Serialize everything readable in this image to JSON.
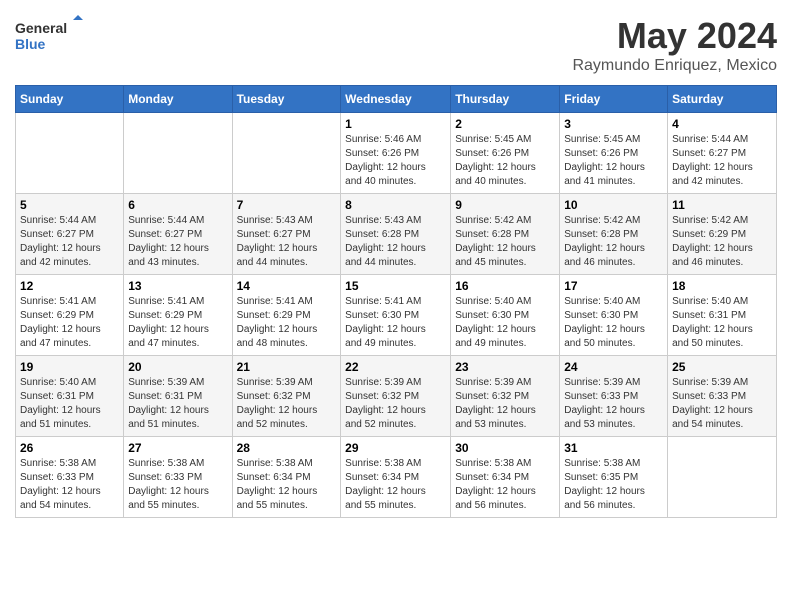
{
  "header": {
    "logo_line1": "General",
    "logo_line2": "Blue",
    "main_title": "May 2024",
    "subtitle": "Raymundo Enriquez, Mexico"
  },
  "days_of_week": [
    "Sunday",
    "Monday",
    "Tuesday",
    "Wednesday",
    "Thursday",
    "Friday",
    "Saturday"
  ],
  "weeks": [
    [
      {
        "day": "",
        "info": ""
      },
      {
        "day": "",
        "info": ""
      },
      {
        "day": "",
        "info": ""
      },
      {
        "day": "1",
        "info": "Sunrise: 5:46 AM\nSunset: 6:26 PM\nDaylight: 12 hours\nand 40 minutes."
      },
      {
        "day": "2",
        "info": "Sunrise: 5:45 AM\nSunset: 6:26 PM\nDaylight: 12 hours\nand 40 minutes."
      },
      {
        "day": "3",
        "info": "Sunrise: 5:45 AM\nSunset: 6:26 PM\nDaylight: 12 hours\nand 41 minutes."
      },
      {
        "day": "4",
        "info": "Sunrise: 5:44 AM\nSunset: 6:27 PM\nDaylight: 12 hours\nand 42 minutes."
      }
    ],
    [
      {
        "day": "5",
        "info": "Sunrise: 5:44 AM\nSunset: 6:27 PM\nDaylight: 12 hours\nand 42 minutes."
      },
      {
        "day": "6",
        "info": "Sunrise: 5:44 AM\nSunset: 6:27 PM\nDaylight: 12 hours\nand 43 minutes."
      },
      {
        "day": "7",
        "info": "Sunrise: 5:43 AM\nSunset: 6:27 PM\nDaylight: 12 hours\nand 44 minutes."
      },
      {
        "day": "8",
        "info": "Sunrise: 5:43 AM\nSunset: 6:28 PM\nDaylight: 12 hours\nand 44 minutes."
      },
      {
        "day": "9",
        "info": "Sunrise: 5:42 AM\nSunset: 6:28 PM\nDaylight: 12 hours\nand 45 minutes."
      },
      {
        "day": "10",
        "info": "Sunrise: 5:42 AM\nSunset: 6:28 PM\nDaylight: 12 hours\nand 46 minutes."
      },
      {
        "day": "11",
        "info": "Sunrise: 5:42 AM\nSunset: 6:29 PM\nDaylight: 12 hours\nand 46 minutes."
      }
    ],
    [
      {
        "day": "12",
        "info": "Sunrise: 5:41 AM\nSunset: 6:29 PM\nDaylight: 12 hours\nand 47 minutes."
      },
      {
        "day": "13",
        "info": "Sunrise: 5:41 AM\nSunset: 6:29 PM\nDaylight: 12 hours\nand 47 minutes."
      },
      {
        "day": "14",
        "info": "Sunrise: 5:41 AM\nSunset: 6:29 PM\nDaylight: 12 hours\nand 48 minutes."
      },
      {
        "day": "15",
        "info": "Sunrise: 5:41 AM\nSunset: 6:30 PM\nDaylight: 12 hours\nand 49 minutes."
      },
      {
        "day": "16",
        "info": "Sunrise: 5:40 AM\nSunset: 6:30 PM\nDaylight: 12 hours\nand 49 minutes."
      },
      {
        "day": "17",
        "info": "Sunrise: 5:40 AM\nSunset: 6:30 PM\nDaylight: 12 hours\nand 50 minutes."
      },
      {
        "day": "18",
        "info": "Sunrise: 5:40 AM\nSunset: 6:31 PM\nDaylight: 12 hours\nand 50 minutes."
      }
    ],
    [
      {
        "day": "19",
        "info": "Sunrise: 5:40 AM\nSunset: 6:31 PM\nDaylight: 12 hours\nand 51 minutes."
      },
      {
        "day": "20",
        "info": "Sunrise: 5:39 AM\nSunset: 6:31 PM\nDaylight: 12 hours\nand 51 minutes."
      },
      {
        "day": "21",
        "info": "Sunrise: 5:39 AM\nSunset: 6:32 PM\nDaylight: 12 hours\nand 52 minutes."
      },
      {
        "day": "22",
        "info": "Sunrise: 5:39 AM\nSunset: 6:32 PM\nDaylight: 12 hours\nand 52 minutes."
      },
      {
        "day": "23",
        "info": "Sunrise: 5:39 AM\nSunset: 6:32 PM\nDaylight: 12 hours\nand 53 minutes."
      },
      {
        "day": "24",
        "info": "Sunrise: 5:39 AM\nSunset: 6:33 PM\nDaylight: 12 hours\nand 53 minutes."
      },
      {
        "day": "25",
        "info": "Sunrise: 5:39 AM\nSunset: 6:33 PM\nDaylight: 12 hours\nand 54 minutes."
      }
    ],
    [
      {
        "day": "26",
        "info": "Sunrise: 5:38 AM\nSunset: 6:33 PM\nDaylight: 12 hours\nand 54 minutes."
      },
      {
        "day": "27",
        "info": "Sunrise: 5:38 AM\nSunset: 6:33 PM\nDaylight: 12 hours\nand 55 minutes."
      },
      {
        "day": "28",
        "info": "Sunrise: 5:38 AM\nSunset: 6:34 PM\nDaylight: 12 hours\nand 55 minutes."
      },
      {
        "day": "29",
        "info": "Sunrise: 5:38 AM\nSunset: 6:34 PM\nDaylight: 12 hours\nand 55 minutes."
      },
      {
        "day": "30",
        "info": "Sunrise: 5:38 AM\nSunset: 6:34 PM\nDaylight: 12 hours\nand 56 minutes."
      },
      {
        "day": "31",
        "info": "Sunrise: 5:38 AM\nSunset: 6:35 PM\nDaylight: 12 hours\nand 56 minutes."
      },
      {
        "day": "",
        "info": ""
      }
    ]
  ]
}
